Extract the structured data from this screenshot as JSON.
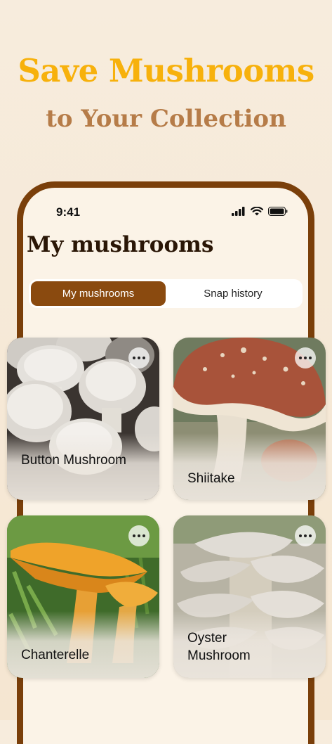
{
  "promo": {
    "headline": "Save Mushrooms",
    "subheadline": "to Your Collection"
  },
  "status_bar": {
    "time": "9:41",
    "icons": [
      "signal-icon",
      "wifi-icon",
      "battery-icon"
    ]
  },
  "screen": {
    "title": "My mushrooms",
    "tabs": [
      {
        "label": "My mushrooms",
        "active": true
      },
      {
        "label": "Snap history",
        "active": false
      }
    ]
  },
  "mushrooms": [
    {
      "name": "Button Mushroom",
      "more_icon": "more-icon"
    },
    {
      "name": "Shiitake",
      "more_icon": "more-icon"
    },
    {
      "name": "Chanterelle",
      "more_icon": "more-icon"
    },
    {
      "name": "Oyster Mushroom",
      "name_line1": "Oyster",
      "name_line2": "Mushroom",
      "more_icon": "more-icon"
    }
  ],
  "colors": {
    "headline": "#f7b10c",
    "subheadline": "#b67c48",
    "frame": "#7a3f0a",
    "active_tab": "#8a4a0f"
  }
}
